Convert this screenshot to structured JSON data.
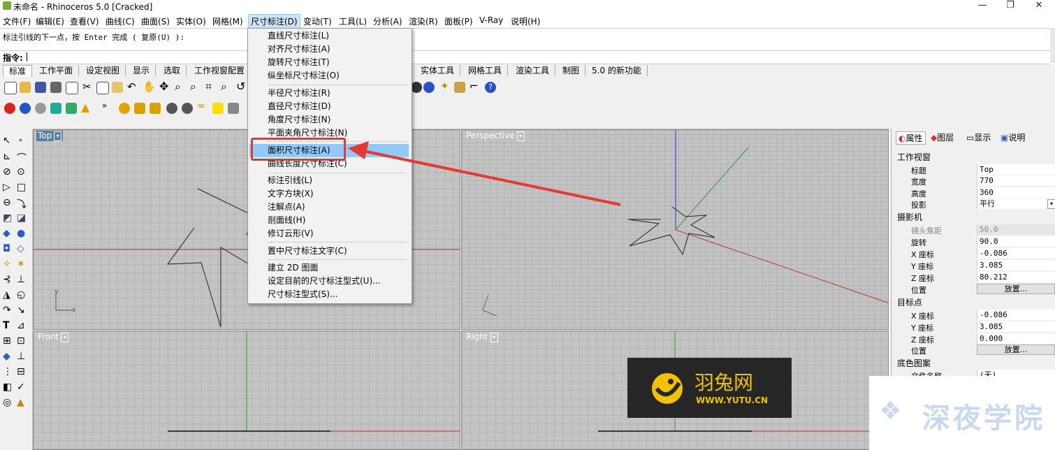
{
  "window": {
    "title": "未命名 - Rhinoceros 5.0 [Cracked]",
    "controls": [
      "—",
      "❐",
      "✕"
    ]
  },
  "menubar": [
    {
      "label": "文件(F)"
    },
    {
      "label": "编辑(E)"
    },
    {
      "label": "查看(V)"
    },
    {
      "label": "曲线(C)"
    },
    {
      "label": "曲面(S)"
    },
    {
      "label": "实体(O)"
    },
    {
      "label": "网格(M)"
    },
    {
      "label": "尺寸标注(D)"
    },
    {
      "label": "变动(T)"
    },
    {
      "label": "工具(L)"
    },
    {
      "label": "分析(A)"
    },
    {
      "label": "渲染(R)"
    },
    {
      "label": "面板(P)"
    },
    {
      "label": "V-Ray"
    },
    {
      "label": "说明(H)"
    }
  ],
  "command": {
    "history": "标注引线的下一点，按 Enter 完成 ( 复原(U) ):",
    "prompt": "指令:"
  },
  "tabs": [
    "标准",
    "工作平面",
    "设定视图",
    "显示",
    "选取",
    "工作视窗配置",
    "实体工具",
    "网格工具",
    "渲染工具",
    "制图",
    "5.0 的新功能"
  ],
  "dropdown": {
    "groups": [
      [
        "直线尺寸标注(L)",
        "对齐尺寸标注(A)",
        "旋转尺寸标注(T)",
        "纵坐标尺寸标注(O)"
      ],
      [
        "半径尺寸标注(R)",
        "直径尺寸标注(D)",
        "角度尺寸标注(N)",
        "平面夹角尺寸标注(N)"
      ],
      [
        "面积尺寸标注(A)",
        "曲线长度尺寸标注(C)"
      ],
      [
        "标注引线(L)",
        "文字方块(X)",
        "注解点(A)",
        "剖面线(H)",
        "修订云形(V)"
      ],
      [
        "置中尺寸标注文字(C)"
      ],
      [
        "建立 2D 图面",
        "设定目前的尺寸标注型式(U)...",
        "尺寸标注型式(S)..."
      ]
    ],
    "highlighted": "面积尺寸标注(A)"
  },
  "viewports": {
    "top": {
      "label": "Top"
    },
    "perspective": {
      "label": "Perspective"
    },
    "front": {
      "label": "Front"
    },
    "right": {
      "label": "Right"
    }
  },
  "panel": {
    "tabs": [
      "属性",
      "图层",
      "显示",
      "说明"
    ],
    "section_viewport": "工作视窗",
    "rows_viewport": [
      {
        "label": "标题",
        "value": "Top"
      },
      {
        "label": "宽度",
        "value": "770"
      },
      {
        "label": "高度",
        "value": "360"
      },
      {
        "label": "投影",
        "value": "平行"
      }
    ],
    "section_camera": "摄影机",
    "rows_camera": [
      {
        "label": "镜头焦距",
        "value": "50.0"
      },
      {
        "label": "旋转",
        "value": "90.0"
      },
      {
        "label": "X 座标",
        "value": "-0.086"
      },
      {
        "label": "Y 座标",
        "value": "3.085"
      },
      {
        "label": "Z 座标",
        "value": "80.212"
      }
    ],
    "position_label": "位置",
    "place_button": "放置...",
    "section_target": "目标点",
    "rows_target": [
      {
        "label": "X 座标",
        "value": "-0.086"
      },
      {
        "label": "Y 座标",
        "value": "3.085"
      },
      {
        "label": "Z 座标",
        "value": "0.000"
      }
    ],
    "section_bg": "底色图案",
    "rows_bg": [
      {
        "label": "文件名称",
        "value": "(无)"
      }
    ]
  },
  "watermarks": {
    "yutu_name": "羽兔网",
    "yutu_url": "WWW.YUTU.CN",
    "night": "深夜学院"
  }
}
